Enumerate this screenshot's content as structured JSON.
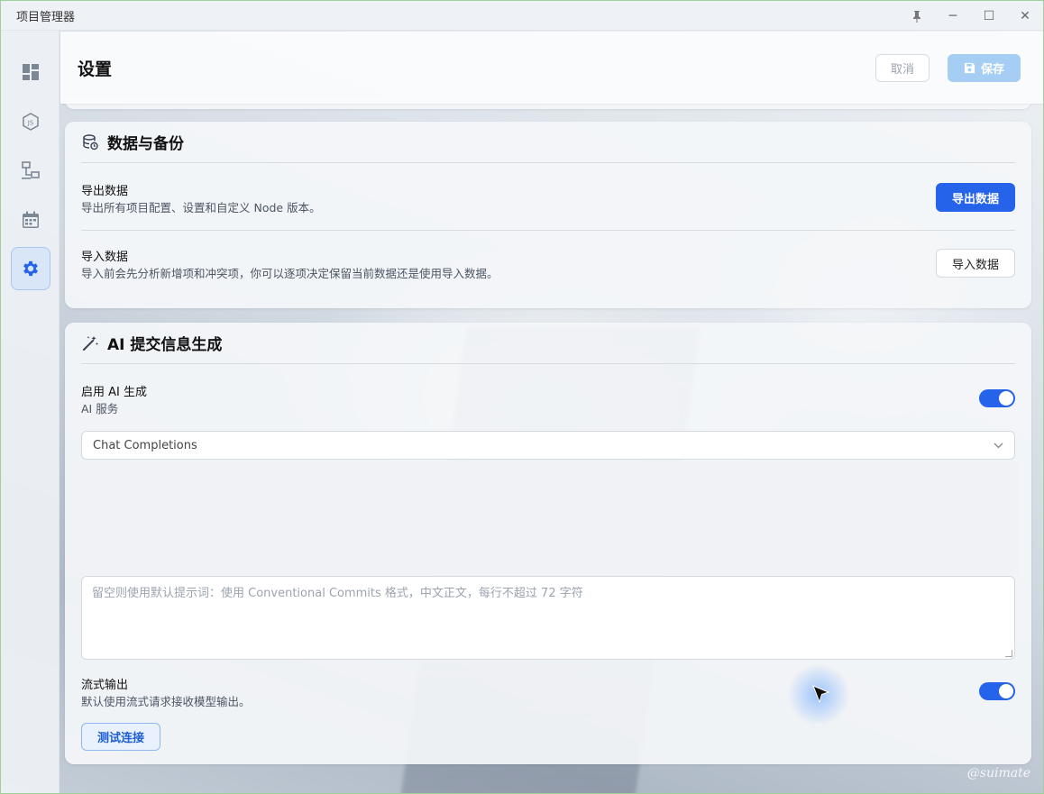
{
  "window": {
    "title": "项目管理器",
    "controls": {
      "pin": "pin-icon",
      "minimize": "─",
      "maximize": "☐",
      "close": "✕"
    }
  },
  "sidebar": {
    "items": [
      {
        "name": "dashboard",
        "icon": "dashboard-icon",
        "active": false
      },
      {
        "name": "node",
        "icon": "nodejs-icon",
        "active": false
      },
      {
        "name": "network",
        "icon": "network-icon",
        "active": false
      },
      {
        "name": "calendar",
        "icon": "calendar-icon",
        "active": false
      },
      {
        "name": "settings",
        "icon": "gear-icon",
        "active": true
      }
    ]
  },
  "header": {
    "title": "设置",
    "cancel_label": "取消",
    "save_label": "保存"
  },
  "data_backup": {
    "title": "数据与备份",
    "export": {
      "title": "导出数据",
      "desc": "导出所有项目配置、设置和自定义 Node 版本。",
      "button": "导出数据"
    },
    "import": {
      "title": "导入数据",
      "desc": "导入前会先分析新增项和冲突项，你可以逐项决定保留当前数据还是使用导入数据。",
      "button": "导入数据"
    }
  },
  "ai_commit": {
    "title": "AI 提交信息生成",
    "enable": {
      "title": "启用 AI 生成",
      "desc": "AI 服务",
      "on": true
    },
    "service_select": {
      "value": "Chat Completions"
    },
    "prompt": {
      "placeholder": "留空则使用默认提示词：使用 Conventional Commits 格式，中文正文，每行不超过 72 字符"
    },
    "stream": {
      "title": "流式输出",
      "desc": "默认使用流式请求接收模型输出。",
      "on": true
    },
    "test_button": "测试连接"
  },
  "watermark": "@suimate",
  "colors": {
    "primary": "#2563eb",
    "save_disabled": "#a6cef5",
    "active_nav": "#d8e6f7"
  }
}
